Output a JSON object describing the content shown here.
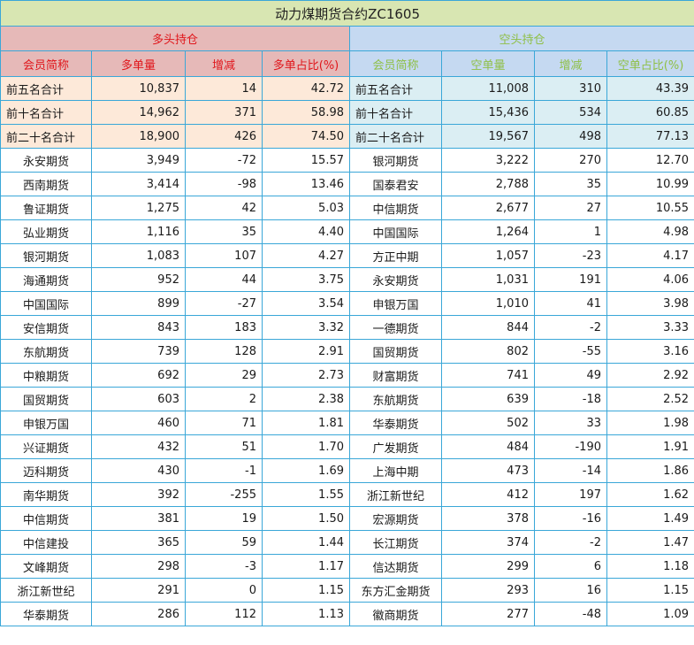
{
  "title": "动力煤期货合约ZC1605",
  "long_group_label": "多头持仓",
  "short_group_label": "空头持仓",
  "headers": [
    "会员简称",
    "多单量",
    "增减",
    "多单占比(%)",
    "会员简称",
    "空单量",
    "增减",
    "空单占比(%)"
  ],
  "colors": {
    "title_bg": "#d8e6b2",
    "long_header_bg": "#e6b9b8",
    "long_header_text": "#e0161b",
    "short_header_bg": "#c5d9f1",
    "short_header_text": "#8fbf46",
    "long_summary_bg": "#fde9d9",
    "short_summary_bg": "#dbeef3",
    "grid": "#3aa7d8"
  },
  "summary_rows": [
    [
      "前五名合计",
      "10,837",
      "14",
      "42.72",
      "前五名合计",
      "11,008",
      "310",
      "43.39"
    ],
    [
      "前十名合计",
      "14,962",
      "371",
      "58.98",
      "前十名合计",
      "15,436",
      "534",
      "60.85"
    ],
    [
      "前二十名合计",
      "18,900",
      "426",
      "74.50",
      "前二十名合计",
      "19,567",
      "498",
      "77.13"
    ]
  ],
  "rows": [
    [
      "永安期货",
      "3,949",
      "-72",
      "15.57",
      "银河期货",
      "3,222",
      "270",
      "12.70"
    ],
    [
      "西南期货",
      "3,414",
      "-98",
      "13.46",
      "国泰君安",
      "2,788",
      "35",
      "10.99"
    ],
    [
      "鲁证期货",
      "1,275",
      "42",
      "5.03",
      "中信期货",
      "2,677",
      "27",
      "10.55"
    ],
    [
      "弘业期货",
      "1,116",
      "35",
      "4.40",
      "中国国际",
      "1,264",
      "1",
      "4.98"
    ],
    [
      "银河期货",
      "1,083",
      "107",
      "4.27",
      "方正中期",
      "1,057",
      "-23",
      "4.17"
    ],
    [
      "海通期货",
      "952",
      "44",
      "3.75",
      "永安期货",
      "1,031",
      "191",
      "4.06"
    ],
    [
      "中国国际",
      "899",
      "-27",
      "3.54",
      "申银万国",
      "1,010",
      "41",
      "3.98"
    ],
    [
      "安信期货",
      "843",
      "183",
      "3.32",
      "一德期货",
      "844",
      "-2",
      "3.33"
    ],
    [
      "东航期货",
      "739",
      "128",
      "2.91",
      "国贸期货",
      "802",
      "-55",
      "3.16"
    ],
    [
      "中粮期货",
      "692",
      "29",
      "2.73",
      "财富期货",
      "741",
      "49",
      "2.92"
    ],
    [
      "国贸期货",
      "603",
      "2",
      "2.38",
      "东航期货",
      "639",
      "-18",
      "2.52"
    ],
    [
      "申银万国",
      "460",
      "71",
      "1.81",
      "华泰期货",
      "502",
      "33",
      "1.98"
    ],
    [
      "兴证期货",
      "432",
      "51",
      "1.70",
      "广发期货",
      "484",
      "-190",
      "1.91"
    ],
    [
      "迈科期货",
      "430",
      "-1",
      "1.69",
      "上海中期",
      "473",
      "-14",
      "1.86"
    ],
    [
      "南华期货",
      "392",
      "-255",
      "1.55",
      "浙江新世纪",
      "412",
      "197",
      "1.62"
    ],
    [
      "中信期货",
      "381",
      "19",
      "1.50",
      "宏源期货",
      "378",
      "-16",
      "1.49"
    ],
    [
      "中信建投",
      "365",
      "59",
      "1.44",
      "长江期货",
      "374",
      "-2",
      "1.47"
    ],
    [
      "文峰期货",
      "298",
      "-3",
      "1.17",
      "信达期货",
      "299",
      "6",
      "1.18"
    ],
    [
      "浙江新世纪",
      "291",
      "0",
      "1.15",
      "东方汇金期货",
      "293",
      "16",
      "1.15"
    ],
    [
      "华泰期货",
      "286",
      "112",
      "1.13",
      "徽商期货",
      "277",
      "-48",
      "1.09"
    ]
  ]
}
